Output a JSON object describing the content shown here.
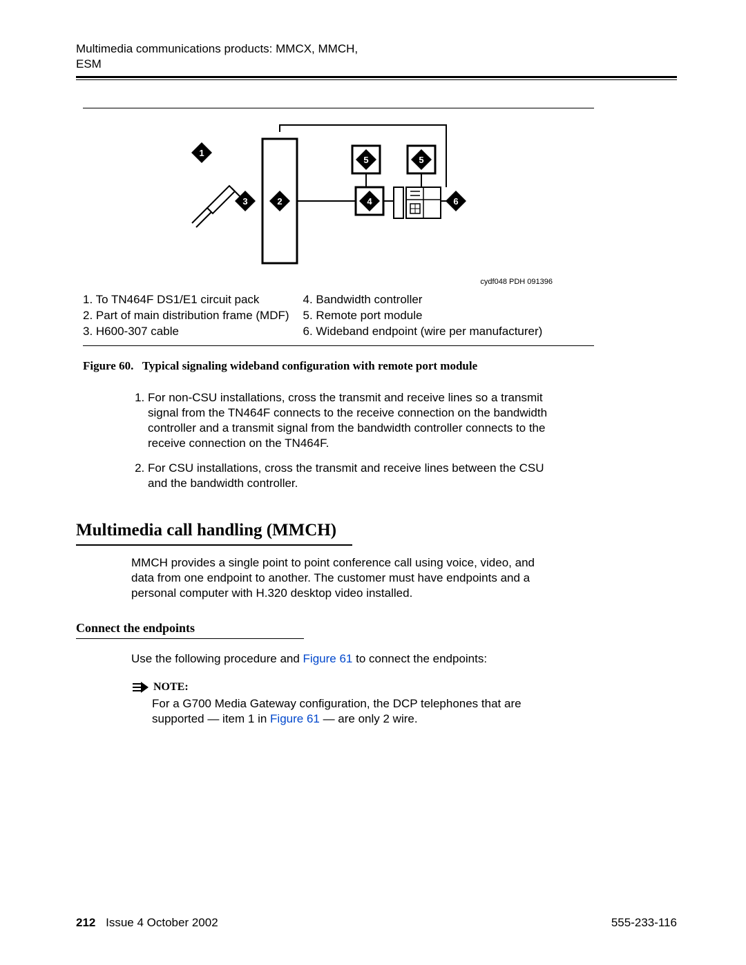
{
  "header": {
    "title": "Multimedia communications products: MMCX, MMCH, ESM"
  },
  "figure": {
    "id_text": "cydf048 PDH 091396",
    "caption_label": "Figure 60.",
    "caption_text": "Typical signaling wideband configuration with remote port module",
    "legend_left": {
      "i1": "1. To TN464F DS1/E1 circuit pack",
      "i2": "2. Part of main distribution frame (MDF)",
      "i3": "3. H600-307 cable"
    },
    "legend_right": {
      "i4": "4. Bandwidth controller",
      "i5": "5. Remote port module",
      "i6": "6. Wideband endpoint (wire per manufacturer)"
    },
    "callouts": {
      "c1": "1",
      "c2": "2",
      "c3": "3",
      "c4": "4",
      "c5": "5",
      "c5b": "5",
      "c6": "6"
    }
  },
  "notes_list": {
    "n1": "For non-CSU installations, cross the transmit and receive lines so a transmit signal from the TN464F connects to the receive connection on the bandwidth controller and a transmit signal from the bandwidth controller connects to the receive connection on the TN464F.",
    "n2": "For CSU installations, cross the transmit and receive lines between the CSU and the bandwidth controller."
  },
  "section": {
    "title": "Multimedia call handling (MMCH)",
    "body": "MMCH provides a single point to point conference call using voice, video, and data from one endpoint to another. The customer must have endpoints and a personal computer with H.320 desktop video installed."
  },
  "subsection": {
    "title": "Connect the endpoints",
    "pre": "Use the following procedure and ",
    "link1": "Figure 61",
    "post": " to connect the endpoints:"
  },
  "note": {
    "label": "NOTE:",
    "pre": "For a G700 Media Gateway configuration, the DCP telephones that are supported — item 1 in ",
    "link": "Figure 61",
    "post": " — are only 2 wire."
  },
  "footer": {
    "page_num": "212",
    "issue": "Issue 4   October 2002",
    "doc_num": "555-233-116"
  }
}
